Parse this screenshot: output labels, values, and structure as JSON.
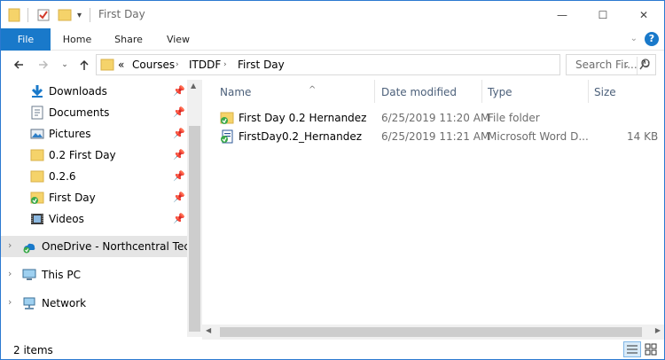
{
  "window": {
    "title": "First Day",
    "minimize_glyph": "—",
    "maximize_glyph": "☐",
    "close_glyph": "✕"
  },
  "ribbon": {
    "tabs": [
      {
        "label": "File"
      },
      {
        "label": "Home"
      },
      {
        "label": "Share"
      },
      {
        "label": "View"
      }
    ],
    "help_glyph": "?"
  },
  "address": {
    "overflow": "«",
    "breadcrumbs": [
      "Courses",
      "ITDDF",
      "First Day"
    ],
    "search_placeholder": "Search Fir..."
  },
  "nav": {
    "quick_access": [
      {
        "label": "Downloads",
        "icon": "download-icon"
      },
      {
        "label": "Documents",
        "icon": "documents-icon"
      },
      {
        "label": "Pictures",
        "icon": "pictures-icon"
      },
      {
        "label": "0.2 First Day",
        "icon": "folder-icon"
      },
      {
        "label": "0.2.6",
        "icon": "folder-icon"
      },
      {
        "label": "First Day",
        "icon": "folder-synced-icon"
      },
      {
        "label": "Videos",
        "icon": "videos-icon"
      }
    ],
    "roots": [
      {
        "label": "OneDrive - Northcentral Techn",
        "icon": "onedrive-icon"
      },
      {
        "label": "This PC",
        "icon": "computer-icon"
      },
      {
        "label": "Network",
        "icon": "network-icon"
      }
    ]
  },
  "columns": {
    "name": "Name",
    "date": "Date modified",
    "type": "Type",
    "size": "Size"
  },
  "files": [
    {
      "name": "First Day 0.2 Hernandez",
      "date": "6/25/2019 11:20 AM",
      "type": "File folder",
      "size": "",
      "icon": "folder-synced-icon"
    },
    {
      "name": "FirstDay0.2_Hernandez",
      "date": "6/25/2019 11:21 AM",
      "type": "Microsoft Word D...",
      "size": "14 KB",
      "icon": "word-doc-synced-icon"
    }
  ],
  "status": {
    "item_count": "2 items"
  },
  "colors": {
    "accent": "#1979ca",
    "folder": "#f5d36a",
    "sync_green": "#3ba94a"
  }
}
